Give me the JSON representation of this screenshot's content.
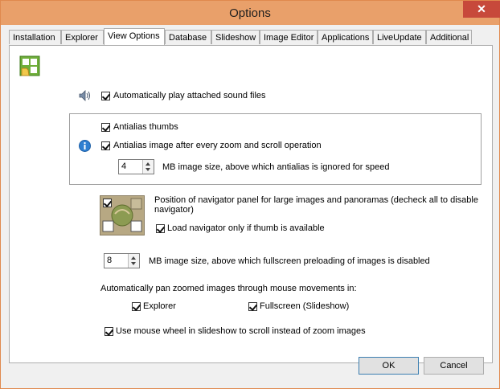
{
  "window": {
    "title": "Options",
    "close_glyph": "✕"
  },
  "tabs": [
    {
      "label": "Installation"
    },
    {
      "label": "Explorer"
    },
    {
      "label": "View Options"
    },
    {
      "label": "Database"
    },
    {
      "label": "Slideshow"
    },
    {
      "label": "Image Editor"
    },
    {
      "label": "Applications"
    },
    {
      "label": "LiveUpdate"
    },
    {
      "label": "Additional"
    }
  ],
  "active_tab": "View Options",
  "view_options": {
    "auto_play_sound": {
      "label": "Automatically play attached sound files",
      "checked": true
    },
    "antialias_thumbs": {
      "label": "Antialias thumbs",
      "checked": true
    },
    "antialias_zoom": {
      "label": "Antialias image after every zoom  and scroll operation",
      "checked": true
    },
    "antialias_size": {
      "value": "4",
      "label": "MB image size, above which antialias is ignored for speed"
    },
    "navigator_text": "Position of navigator panel for large images and panoramas (decheck all to disable navigator)",
    "navigator_thumb_only": {
      "label": "Load navigator only if thumb is available",
      "checked": true
    },
    "preload_size": {
      "value": "8",
      "label": "MB image size, above which fullscreen preloading of images is disabled"
    },
    "auto_pan_heading": "Automatically pan zoomed images through mouse movements in:",
    "pan_explorer": {
      "label": "Explorer",
      "checked": true
    },
    "pan_fullscreen": {
      "label": "Fullscreen (Slideshow)",
      "checked": true
    },
    "mouse_wheel": {
      "label": "Use mouse wheel in slideshow to scroll instead of zoom images",
      "checked": true
    }
  },
  "buttons": {
    "ok": "OK",
    "cancel": "Cancel"
  },
  "icons": {
    "page": "view-options-page-icon",
    "sound": "speaker-icon",
    "info": "info-icon"
  }
}
